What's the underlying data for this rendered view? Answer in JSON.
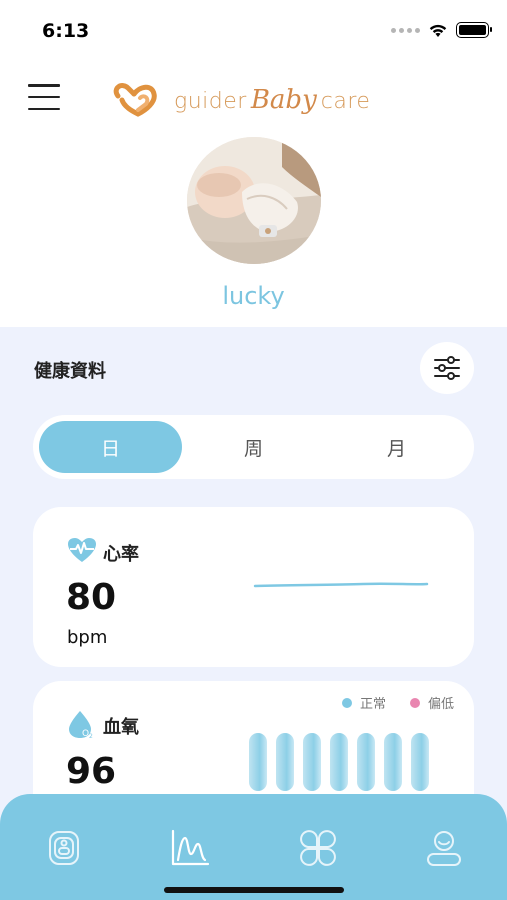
{
  "status_bar": {
    "time": "6:13",
    "battery_level": 1.0
  },
  "header": {
    "logo": {
      "word_left": "guider",
      "word_script": "Baby",
      "word_right": "care"
    }
  },
  "profile": {
    "name": "lucky"
  },
  "health": {
    "title": "健康資料",
    "tabs": [
      {
        "label": "日",
        "active": true
      },
      {
        "label": "周",
        "active": false
      },
      {
        "label": "月",
        "active": false
      }
    ],
    "heart_rate": {
      "label": "心率",
      "value": "80",
      "unit": "bpm"
    },
    "spo2": {
      "label": "血氧",
      "value": "96",
      "legend": [
        {
          "label": "正常",
          "color": "#7ec8e3"
        },
        {
          "label": "偏低",
          "color": "#e986b0"
        }
      ]
    }
  },
  "tab_bar": {
    "items": [
      {
        "icon": "device-icon",
        "active": false
      },
      {
        "icon": "chart-icon",
        "active": true
      },
      {
        "icon": "clover-icon",
        "active": false
      },
      {
        "icon": "profile-icon",
        "active": false
      }
    ]
  },
  "colors": {
    "accent": "#7ec8e3",
    "background": "#eef2fd",
    "logo_orange": "#d2894a",
    "low_pink": "#e986b0"
  }
}
